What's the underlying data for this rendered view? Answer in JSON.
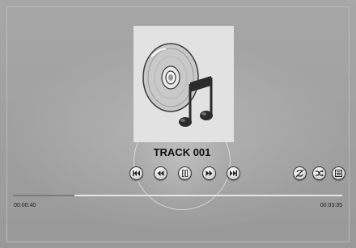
{
  "track": {
    "title": "TRACK 001"
  },
  "album_art": {
    "icon": "cd-music-note-icon"
  },
  "controls": [
    {
      "name": "skip-previous-button",
      "icon": "skip-previous-icon"
    },
    {
      "name": "rewind-button",
      "icon": "rewind-icon"
    },
    {
      "name": "pause-button",
      "icon": "pause-icon"
    },
    {
      "name": "fast-forward-button",
      "icon": "fast-forward-icon"
    },
    {
      "name": "skip-next-button",
      "icon": "skip-next-icon"
    }
  ],
  "options": [
    {
      "name": "repeat-off-button",
      "icon": "repeat-off-icon"
    },
    {
      "name": "shuffle-off-button",
      "icon": "shuffle-off-icon"
    },
    {
      "name": "playlist-button",
      "icon": "playlist-icon"
    }
  ],
  "progress": {
    "elapsed": "00:00:40",
    "total": "00:03:35",
    "fraction": 0.186
  },
  "colors": {
    "background": "#9e9e9e",
    "album_art_bg": "#e2e2e2",
    "progress_fill": "#7c7c7c",
    "progress_track": "#e6e6e6"
  }
}
